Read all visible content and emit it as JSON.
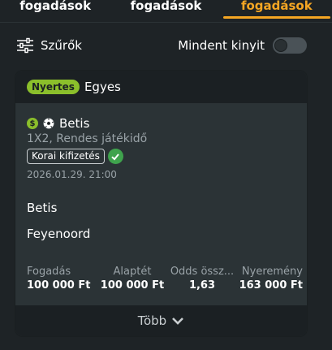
{
  "tabs": [
    {
      "label": "fogadások"
    },
    {
      "label": "fogadások"
    },
    {
      "label": "fogadások"
    }
  ],
  "filters": {
    "label": "Szűrők",
    "icon": "sliders-icon"
  },
  "expand_all": {
    "label": "Mindent kinyit",
    "state": "off"
  },
  "bet": {
    "status": "Nyertes",
    "type": "Egyes",
    "selection": "Betis",
    "market": "1X2, Rendes játékidő",
    "early_payout": "Korai kifizetés",
    "date": "2026.01.29.  21:00",
    "home": "Betis",
    "away": "Feyenoord",
    "stats": [
      {
        "label": "Fogadás",
        "value": "100 000 Ft"
      },
      {
        "label": "Alaptét",
        "value": "100 000 Ft"
      },
      {
        "label": "Odds össz...",
        "value": "1,63"
      },
      {
        "label": "Nyeremény",
        "value": "163 000 Ft"
      }
    ],
    "more": "Több"
  },
  "colors": {
    "accent": "#f5a623",
    "win": "#8bbf2b",
    "check": "#3fa34d"
  }
}
